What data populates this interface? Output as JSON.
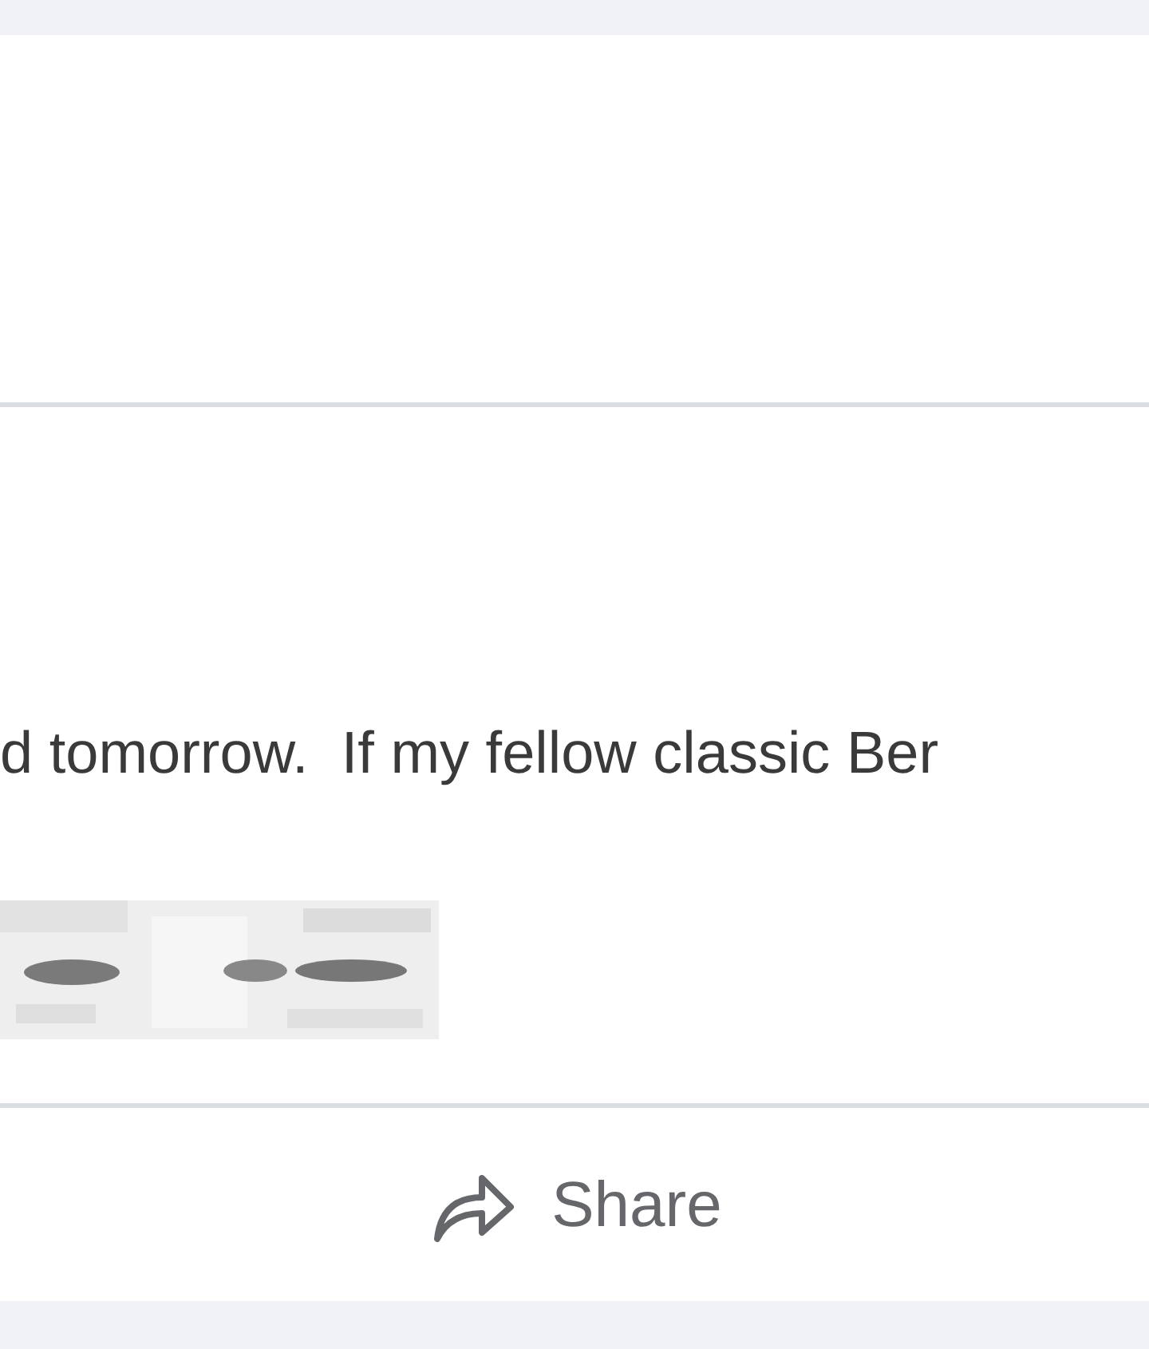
{
  "post": {
    "text": "d tomorrow.  If my fellow classic Ber"
  },
  "actions": [
    {
      "label": "Share"
    }
  ]
}
